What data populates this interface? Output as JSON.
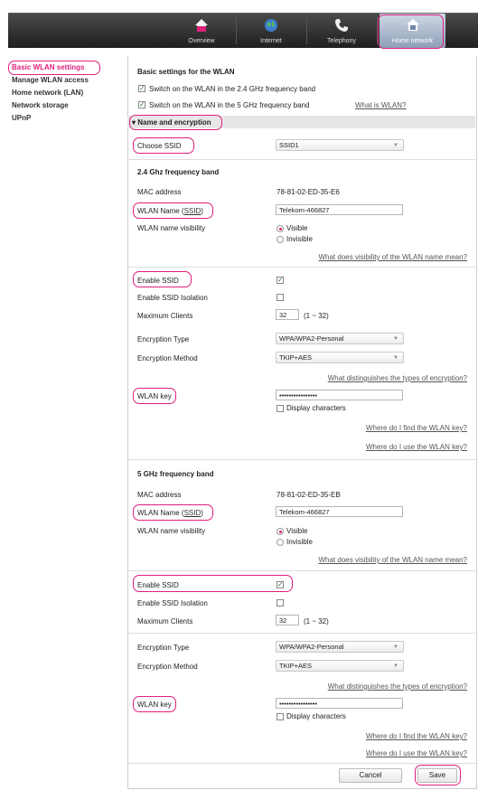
{
  "nav": {
    "overview": "Overview",
    "internet": "Internet",
    "telephony": "Telephony",
    "home_network": "Home network"
  },
  "sidebar": {
    "items": [
      "Basic WLAN settings",
      "Manage WLAN access",
      "Home network (LAN)",
      "Network storage",
      "UPnP"
    ]
  },
  "main": {
    "heading": "Basic settings for the WLAN",
    "switch_24": "Switch on the WLAN in the 2.4 GHz frequency band",
    "switch_5": "Switch on the WLAN in the 5 GHz frequency band",
    "what_is_wlan": "What is WLAN?",
    "section_title": "Name and encryption",
    "choose_ssid": "Choose SSID",
    "ssid_value": "SSID1"
  },
  "band24": {
    "title": "2.4 Ghz frequency band",
    "mac_label": "MAC address",
    "mac": "78-81-02-ED-35-E6",
    "wlan_name_label": "WLAN Name (",
    "ssid_link": "SSID",
    "wlan_name_close": ")",
    "wlan_name": "Telekom-466827",
    "visibility_label": "WLAN name visibility",
    "visible": "Visible",
    "invisible": "Invisible",
    "visibility_help": "What does visibility of the WLAN name mean?",
    "enable_ssid": "Enable SSID",
    "isolation": "Enable SSID Isolation",
    "max_clients_label": "Maximum Clients",
    "max_clients": "32",
    "range": "(1 ~ 32)",
    "enc_type_label": "Encryption Type",
    "enc_type": "WPA/WPA2-Personal",
    "enc_method_label": "Encryption Method",
    "enc_method": "TKIP+AES",
    "enc_help": "What distinguishes the types of encryption?",
    "key_label": "WLAN key",
    "key": "••••••••••••••••",
    "display_chars": "Display characters",
    "find_key": "Where do I find the WLAN key?",
    "use_key": "Where do I use the WLAN key?"
  },
  "band5": {
    "title": "5 GHz frequency band",
    "mac_label": "MAC address",
    "mac": "78-81-02-ED-35-EB",
    "wlan_name_label": "WLAN Name (",
    "ssid_link": "SSID",
    "wlan_name_close": ")",
    "wlan_name": "Telekom-466827",
    "visibility_label": "WLAN name visibility",
    "visible": "Visible",
    "invisible": "Invisible",
    "visibility_help": "What does visibility of the WLAN name mean?",
    "enable_ssid": "Enable SSID",
    "isolation": "Enable SSID Isolation",
    "max_clients_label": "Maximum Clients",
    "max_clients": "32",
    "range": "(1 ~ 32)",
    "enc_type_label": "Encryption Type",
    "enc_type": "WPA/WPA2-Personal",
    "enc_method_label": "Encryption Method",
    "enc_method": "TKIP+AES",
    "enc_help": "What distinguishes the types of encryption?",
    "key_label": "WLAN key",
    "key": "••••••••••••••••",
    "display_chars": "Display characters",
    "find_key": "Where do I find the WLAN key?",
    "use_key": "Where do I use the WLAN key?"
  },
  "footer": {
    "cancel": "Cancel",
    "save": "Save"
  },
  "colors": {
    "accent": "#e0207a",
    "check": "#2a7a2a"
  }
}
